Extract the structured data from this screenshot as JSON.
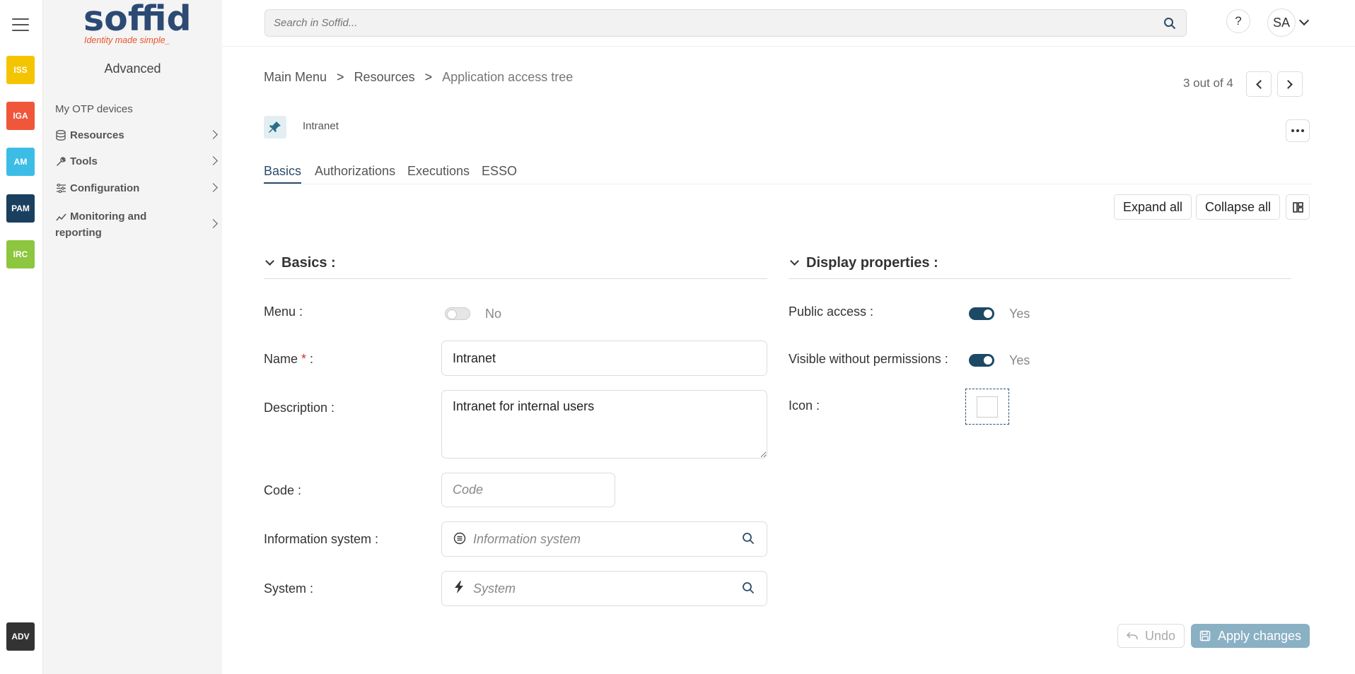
{
  "modules": [
    {
      "label": "ISS",
      "color": "#f5c400"
    },
    {
      "label": "IGA",
      "color": "#f0563a"
    },
    {
      "label": "AM",
      "color": "#3cbde6"
    },
    {
      "label": "PAM",
      "color": "#1b3f5e"
    },
    {
      "label": "IRC",
      "color": "#8dc63f"
    },
    {
      "label": "ADV",
      "color": "#333333"
    }
  ],
  "logo": {
    "word_main": "soff",
    "word_accent": "i",
    "word_end": "d",
    "tagline": "Identity made simple_"
  },
  "sidebar": {
    "title": "Advanced",
    "items": [
      {
        "label": "My OTP devices",
        "icon": "none"
      },
      {
        "label": "Resources",
        "icon": "database-icon"
      },
      {
        "label": "Tools",
        "icon": "wrench-icon"
      },
      {
        "label": "Configuration",
        "icon": "sliders-icon"
      },
      {
        "label": "Monitoring and reporting",
        "icon": "chart-line-icon"
      }
    ]
  },
  "topbar": {
    "search_placeholder": "Search in Soffid...",
    "help_label": "?",
    "user_initials": "SA"
  },
  "breadcrumb": {
    "items": [
      "Main Menu",
      "Resources",
      "Application access tree"
    ],
    "separator": ">"
  },
  "pager": {
    "text": "3 out of 4"
  },
  "record": {
    "name": "Intranet",
    "icon": "pin-icon"
  },
  "tabs": [
    "Basics",
    "Authorizations",
    "Executions",
    "ESSO"
  ],
  "actions": {
    "expand_all": "Expand all",
    "collapse_all": "Collapse all"
  },
  "basics": {
    "title": "Basics :",
    "menu_label": "Menu :",
    "menu_value": "No",
    "name_label": "Name",
    "name_required": "*",
    "name_suffix": " :",
    "name_value": "Intranet",
    "description_label": "Description :",
    "description_value": "Intranet for internal users",
    "code_label": "Code :",
    "code_placeholder": "Code",
    "infosys_label": "Information system :",
    "infosys_placeholder": "Information system",
    "system_label": "System :",
    "system_placeholder": "System"
  },
  "display": {
    "title": "Display properties :",
    "public_label": "Public access :",
    "public_value": "Yes",
    "visible_label": "Visible without permissions :",
    "visible_value": "Yes",
    "icon_label": "Icon :"
  },
  "footer": {
    "undo": "Undo",
    "apply": "Apply changes"
  },
  "colors": {
    "accent": "#2b4c6a",
    "toggle_on": "#1c4a66",
    "apply_disabled": "#8ab0c4",
    "required": "#d32f2f"
  }
}
